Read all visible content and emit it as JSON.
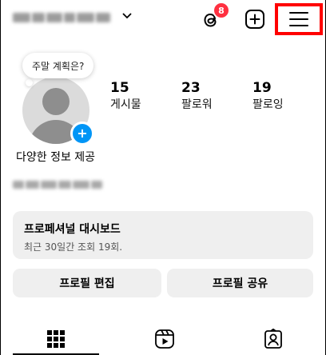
{
  "header": {
    "username": "■■■■■■",
    "dropdown_icon": "chevron-down-icon",
    "threads_badge_count": "8",
    "threads_icon": "threads-icon",
    "create_icon": "plus-square-icon",
    "menu_icon": "hamburger-menu-icon",
    "highlight_color": "#ff0000"
  },
  "profile": {
    "note_text": "주말 계획은?",
    "avatar_add_symbol": "+",
    "display_name": "다양한 정보 제공",
    "blurred_info": "■■■■■■"
  },
  "stats": [
    {
      "value": "15",
      "label": "게시물"
    },
    {
      "value": "23",
      "label": "팔로워"
    },
    {
      "value": "19",
      "label": "팔로잉"
    }
  ],
  "dashboard": {
    "title": "프로페셔널 대시보드",
    "subtitle": "최근 30일간 조회 19회."
  },
  "buttons": {
    "edit_profile": "프로필 편집",
    "share_profile": "프로필 공유"
  },
  "tabs": [
    {
      "name": "grid-icon"
    },
    {
      "name": "reels-icon"
    },
    {
      "name": "tagged-icon"
    }
  ],
  "colors": {
    "accent_blue": "#0095f6",
    "badge_red": "#ff3040",
    "button_bg": "#efefef"
  }
}
